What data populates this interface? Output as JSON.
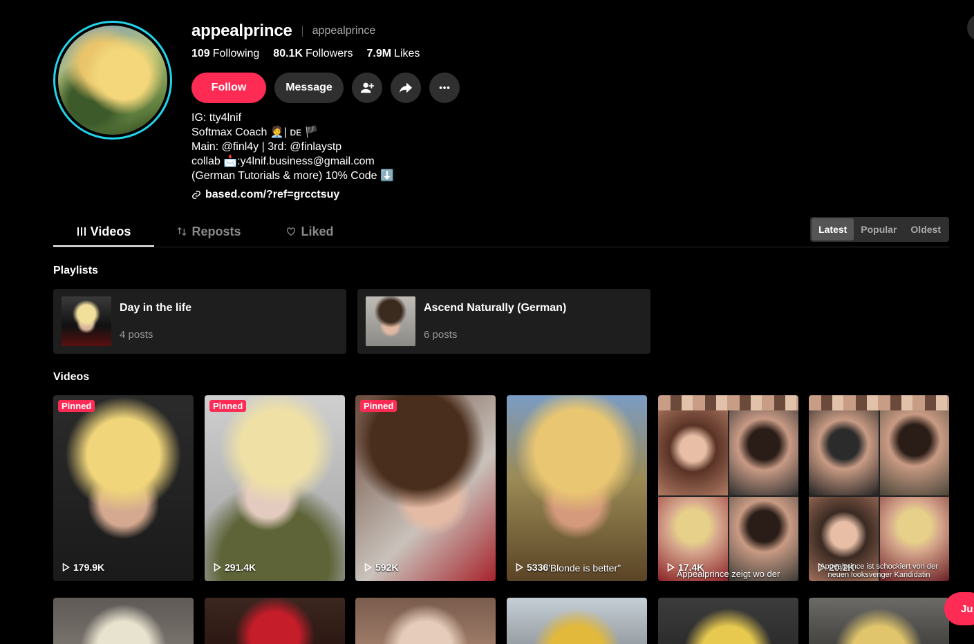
{
  "profile": {
    "username": "appealprince",
    "nickname": "appealprince",
    "following_count": "109",
    "following_label": "Following",
    "followers_count": "80.1K",
    "followers_label": "Followers",
    "likes_count": "7.9M",
    "likes_label": "Likes",
    "avatar_icon": "profile-photo",
    "accent_color": "#fe2c55",
    "ring_color": "#20d5ec"
  },
  "actions": {
    "follow": "Follow",
    "message": "Message",
    "add_friend_icon": "add-person-icon",
    "share_icon": "share-arrow-icon",
    "more_icon": "more-dots-icon"
  },
  "bio": {
    "line1": "IG: tty4lnif",
    "line2": "Softmax Coach 🧑‍💼| ᴅᴇ 🏴",
    "line3": "Main: @finl4y | 3rd: @finlaystp",
    "line4": "collab 📩:y4lnif.business@gmail.com",
    "line5": "(German Tutorials & more) 10% Code ⬇️",
    "link": "based.com/?ref=grcctsuy"
  },
  "tabs": {
    "videos": "Videos",
    "reposts": "Reposts",
    "liked": "Liked"
  },
  "sort": {
    "latest": "Latest",
    "popular": "Popular",
    "oldest": "Oldest",
    "selected": "Latest"
  },
  "sections": {
    "playlists": "Playlists",
    "videos": "Videos"
  },
  "playlists": [
    {
      "title": "Day in the life",
      "count": "4 posts"
    },
    {
      "title": "Ascend Naturally (German)",
      "count": "6 posts"
    }
  ],
  "videos": [
    {
      "pinned": "Pinned",
      "views": "179.9K"
    },
    {
      "pinned": "Pinned",
      "views": "291.4K"
    },
    {
      "pinned": "Pinned",
      "views": "592K"
    },
    {
      "views": "5336",
      "caption": "\"Blonde is better\""
    },
    {
      "views": "17.4K",
      "caption": "Appealprince zeigt wo der"
    },
    {
      "views": "20.2K",
      "caption": "Appealprince ist schockiert von der neuen looksvenger Kandidatin"
    }
  ],
  "floating": {
    "label": "Ju"
  }
}
